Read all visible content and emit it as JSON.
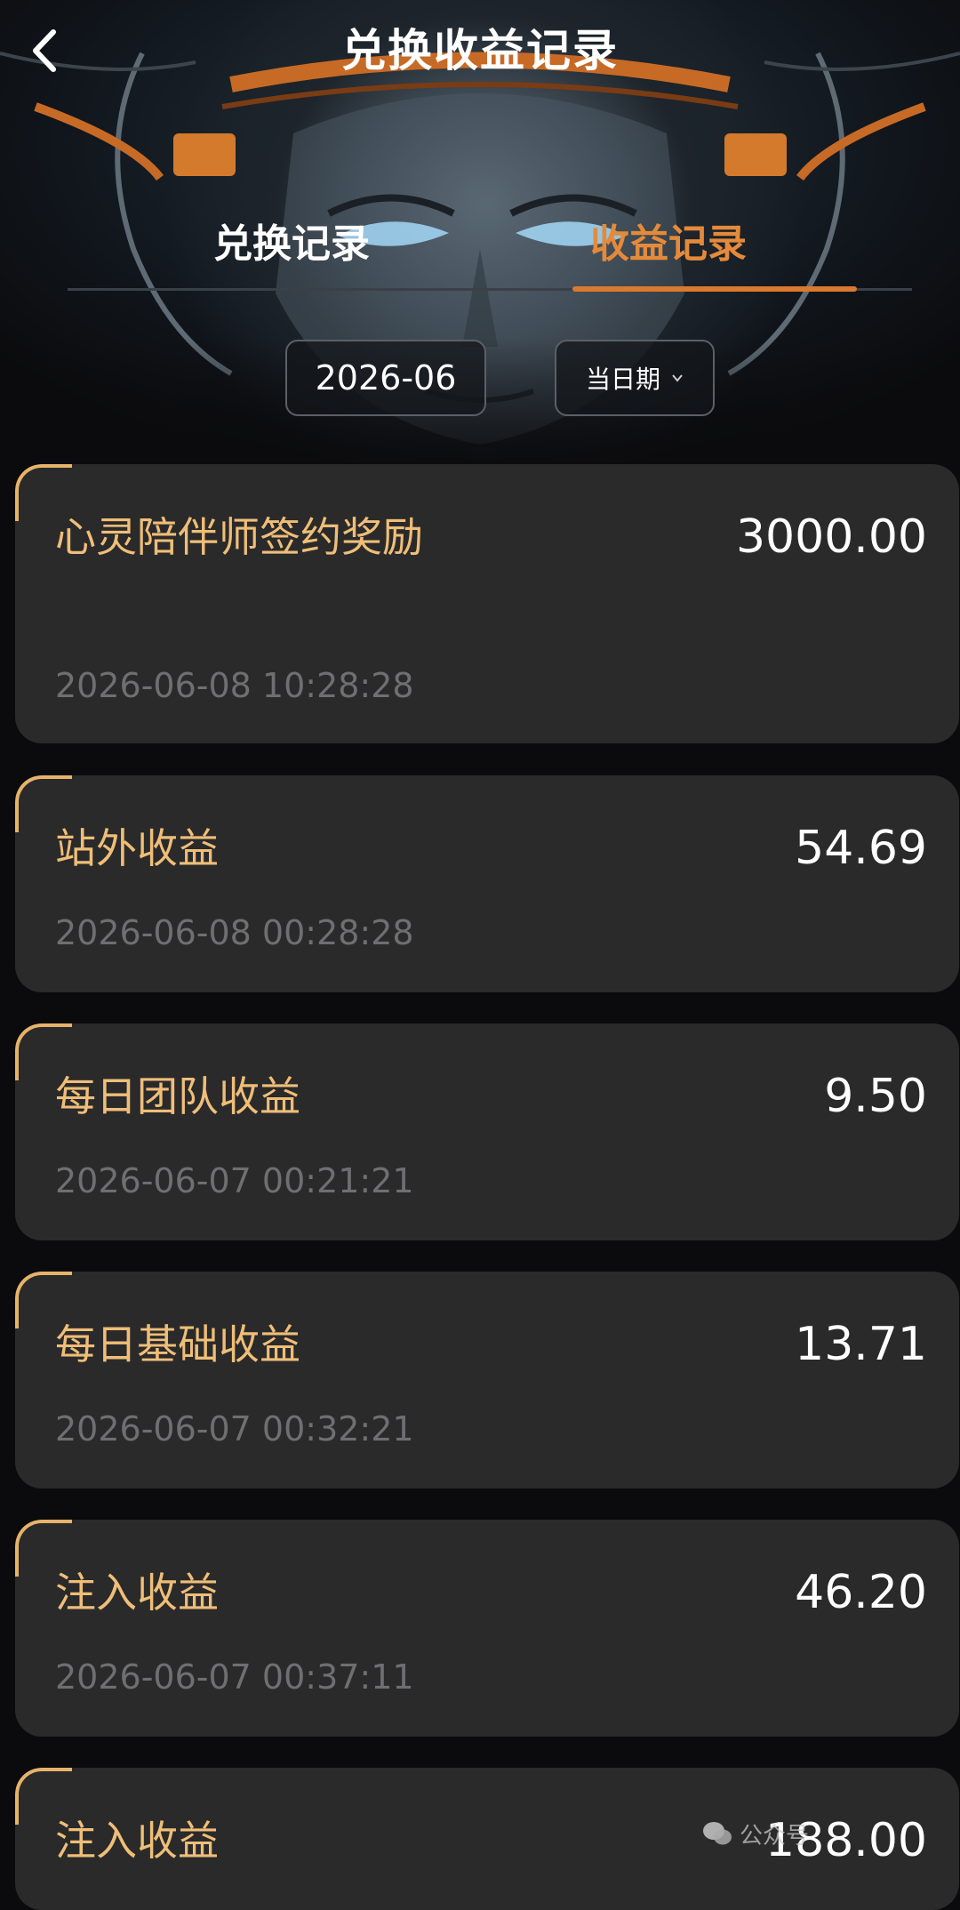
{
  "header": {
    "title": "兑换收益记录"
  },
  "tabs": [
    {
      "label": "兑换记录",
      "active": false
    },
    {
      "label": "收益记录",
      "active": true
    }
  ],
  "filters": {
    "month": "2026-06",
    "date_label": "当日期"
  },
  "records": [
    {
      "title": "心灵陪伴师签约奖励",
      "amount": "3000.00",
      "time": "2026-06-08 10:28:28"
    },
    {
      "title": "站外收益",
      "amount": "54.69",
      "time": "2026-06-08 00:28:28"
    },
    {
      "title": "每日团队收益",
      "amount": "9.50",
      "time": "2026-06-07 00:21:21"
    },
    {
      "title": "每日基础收益",
      "amount": "13.71",
      "time": "2026-06-07 00:32:21"
    },
    {
      "title": "注入收益",
      "amount": "46.20",
      "time": "2026-06-07 00:37:11"
    },
    {
      "title": "注入收益",
      "amount": "188.00",
      "time": ""
    }
  ],
  "watermark": {
    "text": "公众号",
    "icon": "wechat-icon"
  },
  "colors": {
    "accent": "#e48a3a",
    "record_title": "#efbe78",
    "card_bg": "#2a2a2b",
    "page_bg": "#0b0b0d"
  }
}
